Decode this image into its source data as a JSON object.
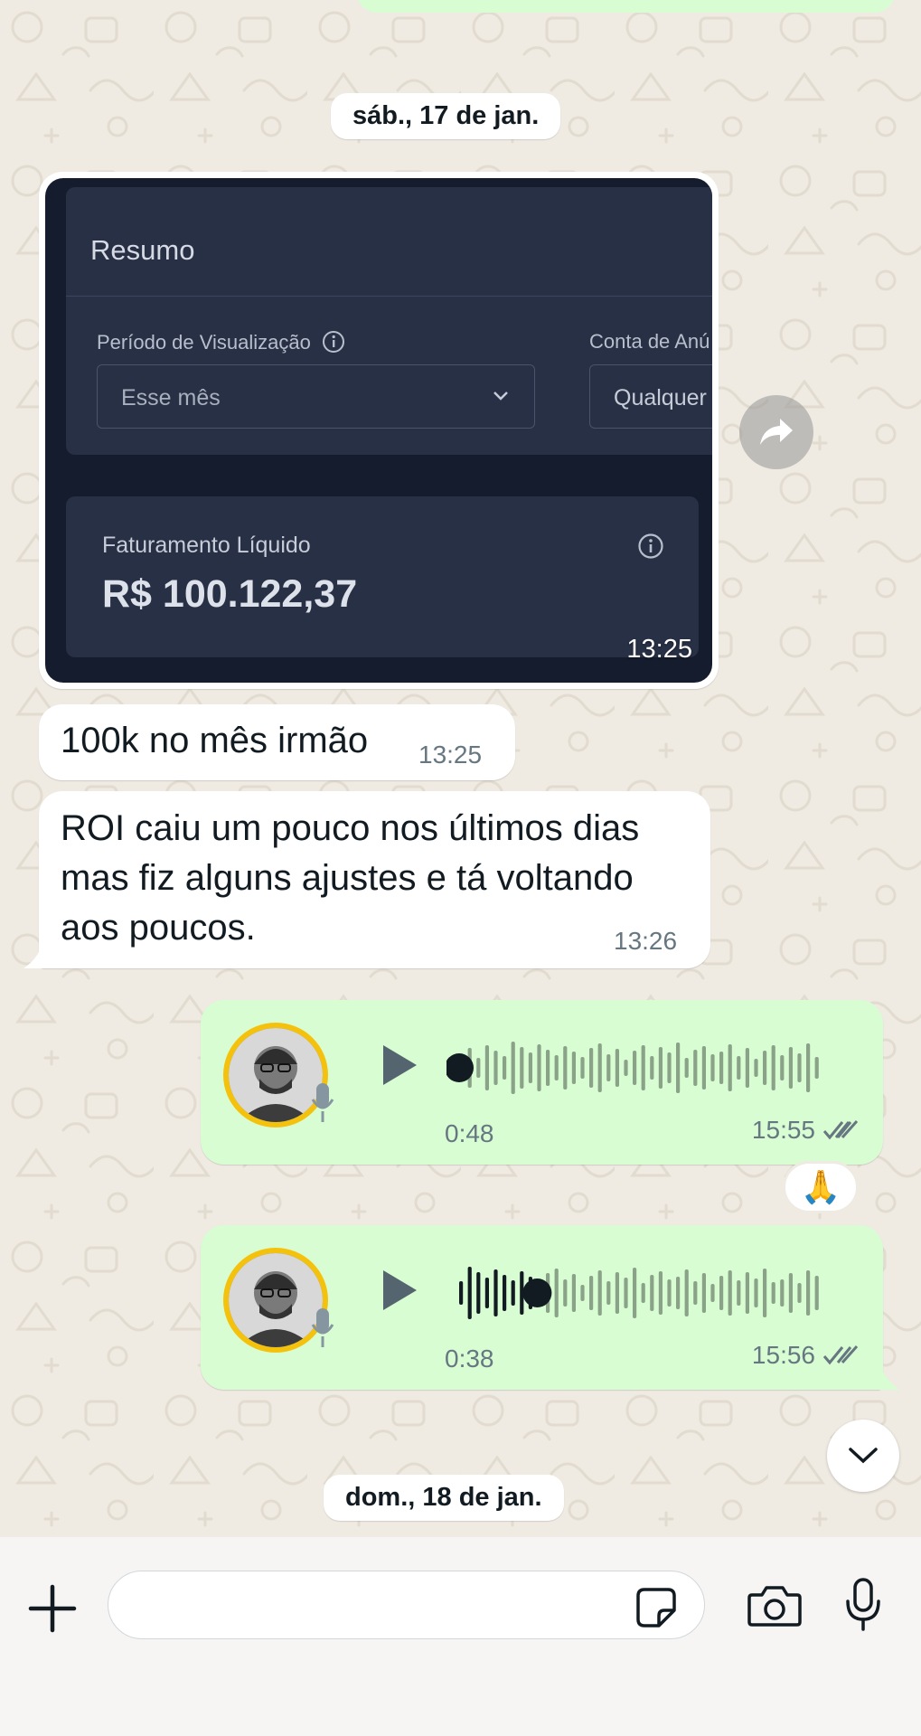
{
  "chat": {
    "date_separator_1": "sáb., 17 de jan.",
    "date_separator_2": "dom., 18 de jan.",
    "image_message": {
      "time": "13:25",
      "screenshot": {
        "card_title": "Resumo",
        "period_label": "Período de Visualização",
        "period_value": "Esse mês",
        "account_label": "Conta de Anú",
        "account_value": "Qualquer",
        "revenue_label": "Faturamento Líquido",
        "revenue_value": "R$ 100.122,37"
      }
    },
    "messages": [
      {
        "text": "100k no mês irmão",
        "time": "13:25"
      },
      {
        "text_lines": [
          "ROI caiu um pouco nos últimos dias",
          "mas fiz alguns ajustes e tá voltando",
          "aos poucos."
        ],
        "time": "13:26"
      }
    ],
    "voice_notes": [
      {
        "duration": "0:48",
        "time": "15:55",
        "progress": 0.0,
        "reaction": "🙏"
      },
      {
        "duration": "0:38",
        "time": "15:56",
        "progress": 0.21
      }
    ]
  },
  "icons": {
    "forward": "forward-icon",
    "play": "play-icon",
    "mic_badge": "microphone-icon",
    "read_receipt": "double-check-icon",
    "scroll_down": "chevron-down-icon",
    "attach": "plus-icon",
    "sticker": "sticker-icon",
    "camera": "camera-icon",
    "voice_record": "microphone-icon"
  },
  "colors": {
    "outgoing_bubble": "#d9fdd3",
    "incoming_bubble": "#ffffff",
    "background": "#efeae2",
    "avatar_ring": "#f4c20d"
  }
}
